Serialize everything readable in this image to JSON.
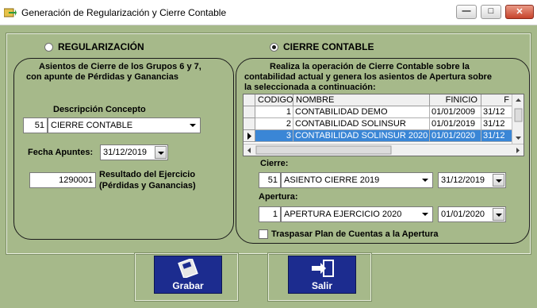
{
  "window": {
    "title": "Generación de Regularización y Cierre Contable",
    "controls": {
      "minimize": "—",
      "maximize": "□",
      "close": "✕"
    }
  },
  "mode": {
    "regularizacion_label": "REGULARIZACIÓN",
    "cierre_label": "CIERRE CONTABLE",
    "selected": "cierre"
  },
  "left": {
    "heading_line1": "Asientos de Cierre de los Grupos 6 y 7,",
    "heading_line2": "con apunte de Pérdidas y Ganancias",
    "concepto_label": "Descripción Concepto",
    "concepto_code": "51",
    "concepto_value": "CIERRE CONTABLE",
    "fecha_label": "Fecha Apuntes:",
    "fecha_value": "31/12/2019",
    "resultado_value": "1290001",
    "resultado_label1": "Resultado del Ejercicio",
    "resultado_label2": "(Pérdidas y Ganancias)"
  },
  "right": {
    "heading_line1": "Realiza la operación de Cierre Contable sobre la",
    "heading_line2": "contabilidad actual y genera los asientos de Apertura sobre",
    "heading_line3": "la seleccionada a continuación:",
    "table": {
      "headers": [
        "CODIGO",
        "NOMBRE",
        "FINICIO",
        "F"
      ],
      "rows": [
        {
          "codigo": "1",
          "nombre": "CONTABILIDAD DEMO",
          "finicio": "01/01/2009",
          "f": "31/12"
        },
        {
          "codigo": "2",
          "nombre": "CONTABILIDAD SOLINSUR",
          "finicio": "01/01/2019",
          "f": "31/12"
        },
        {
          "codigo": "3",
          "nombre": "CONTABILIDAD SOLINSUR 2020",
          "finicio": "01/01/2020",
          "f": "31/12"
        }
      ],
      "selected_row": 3
    },
    "cierre_label": "Cierre:",
    "cierre_code": "51",
    "cierre_value": "ASIENTO CIERRE 2019",
    "cierre_date": "31/12/2019",
    "apertura_label": "Apertura:",
    "apertura_code": "1",
    "apertura_value": "APERTURA EJERCICIO 2020",
    "apertura_date": "01/01/2020",
    "traspasar_label": "Traspasar Plan de Cuentas a la Apertura",
    "traspasar_checked": false
  },
  "buttons": {
    "grabar": "Grabar",
    "salir": "Salir"
  },
  "colors": {
    "background": "#a6b98a",
    "button": "#1c2c8f",
    "selection": "#3a86d6"
  }
}
